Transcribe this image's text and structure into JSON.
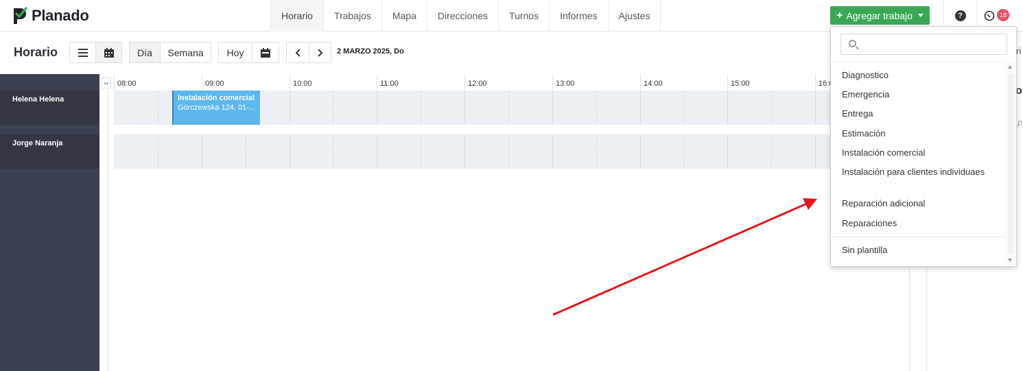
{
  "app": {
    "name": "Planado"
  },
  "nav": {
    "items": [
      {
        "label": "Horario",
        "active": true
      },
      {
        "label": "Trabajos"
      },
      {
        "label": "Mapa"
      },
      {
        "label": "Direcciones"
      },
      {
        "label": "Turnos"
      },
      {
        "label": "Informes"
      },
      {
        "label": "Ajustes"
      }
    ],
    "add_job_label": "Agregar trabajo",
    "help_icon": "?",
    "notifications_count": "18"
  },
  "toolbar": {
    "title": "Horario",
    "view_day": "Día",
    "view_week": "Semana",
    "today": "Hoy",
    "date": "2 MARZO 2025, Do",
    "partial_right": "ri"
  },
  "schedule": {
    "hours": [
      "08:00",
      "09:00",
      "10:00",
      "11:00",
      "12:00",
      "13:00",
      "14:00",
      "15:00",
      "16:00"
    ],
    "resources": [
      {
        "name": "Helena Helena"
      },
      {
        "name": "Jorge Naranja"
      }
    ],
    "jobs": [
      {
        "title": "Instalación comercial",
        "address": "Górczewska 124, 01-..."
      }
    ],
    "side_fragment_o": "o",
    "side_fragment_p": "p"
  },
  "dropdown": {
    "search_placeholder": "",
    "templates": [
      "Diagnostico",
      "Emergencia",
      "Entrega",
      "Estimación",
      "Instalación comercial",
      "Instalación para clientes individuaes",
      "Reparación adicional",
      "Reparaciones"
    ],
    "no_template": "Sin plantilla"
  },
  "colors": {
    "accent_green": "#3aa757",
    "sidebar": "#3c4150",
    "job_blue": "#5cb8ec",
    "badge": "#e8516a",
    "annotation_arrow": "#e3161b"
  }
}
